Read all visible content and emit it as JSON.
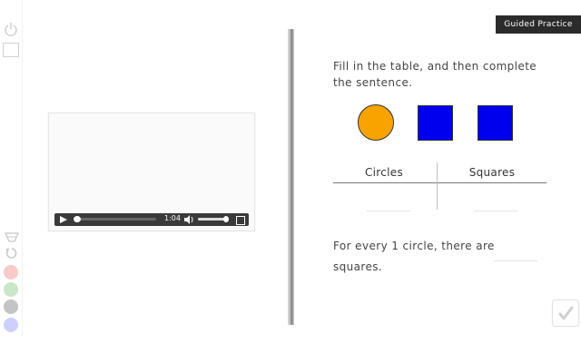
{
  "header": {
    "badge": "Guided Practice"
  },
  "toolbar": {
    "tools": [
      "power-icon",
      "rectangle-icon",
      "eraser-icon",
      "undo-icon"
    ],
    "swatches": [
      "#f8caca",
      "#c8e6c8",
      "#c4c4c4",
      "#cfcfff"
    ]
  },
  "video": {
    "time": "1:04",
    "progress": 0.02,
    "volume": 0.85
  },
  "question": {
    "instruction": "Fill in the table, and then complete the sentence."
  },
  "shapes": {
    "circle_color": "#f8a300",
    "square_color": "#0000ee",
    "circle_count": 1,
    "square_count": 2
  },
  "table": {
    "headers": [
      "Circles",
      "Squares"
    ],
    "values": [
      "",
      ""
    ]
  },
  "sentence": {
    "part1": "For every 1 circle, there are",
    "part2": "squares.",
    "blank_value": ""
  }
}
